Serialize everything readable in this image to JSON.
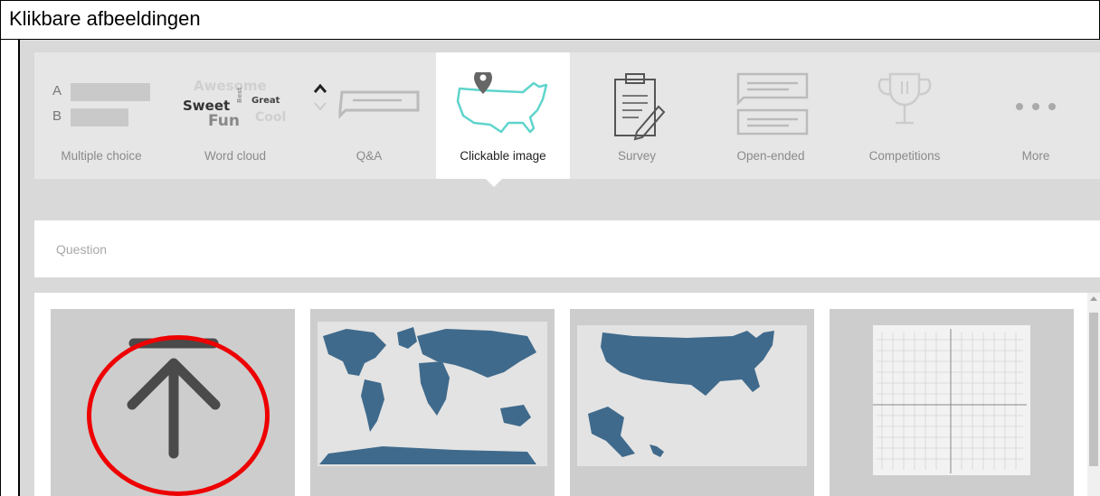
{
  "doc": {
    "title": "Klikbare afbeeldingen"
  },
  "toolbar": {
    "items": [
      {
        "label": "Multiple choice",
        "icon": "multiple-choice-icon"
      },
      {
        "label": "Word cloud",
        "icon": "word-cloud-icon"
      },
      {
        "label": "Q&A",
        "icon": "qa-icon"
      },
      {
        "label": "Clickable image",
        "icon": "map-pin-icon",
        "active": true
      },
      {
        "label": "Survey",
        "icon": "clipboard-icon"
      },
      {
        "label": "Open-ended",
        "icon": "speech-bubbles-icon"
      },
      {
        "label": "Competitions",
        "icon": "trophy-icon"
      },
      {
        "label": "More",
        "icon": "more-dots-icon"
      }
    ],
    "mc_letters": [
      "A",
      "B"
    ],
    "word_cloud": {
      "w1": "Awesome",
      "w2": "Sweet",
      "w3": "Best",
      "w4": "Great",
      "w5": "Fun",
      "w6": "Cool"
    }
  },
  "question": {
    "placeholder": "Question"
  },
  "gallery": {
    "items": [
      {
        "name": "upload-image",
        "icon": "upload-arrow-icon"
      },
      {
        "name": "world-map",
        "icon": "world-map-icon"
      },
      {
        "name": "usa-map",
        "icon": "usa-map-icon"
      },
      {
        "name": "coordinate-grid",
        "icon": "grid-icon"
      }
    ]
  },
  "colors": {
    "map_blue": "#3f6a8c",
    "annotation_red": "#ee0000",
    "pin_outline": "#5fd4cc"
  }
}
